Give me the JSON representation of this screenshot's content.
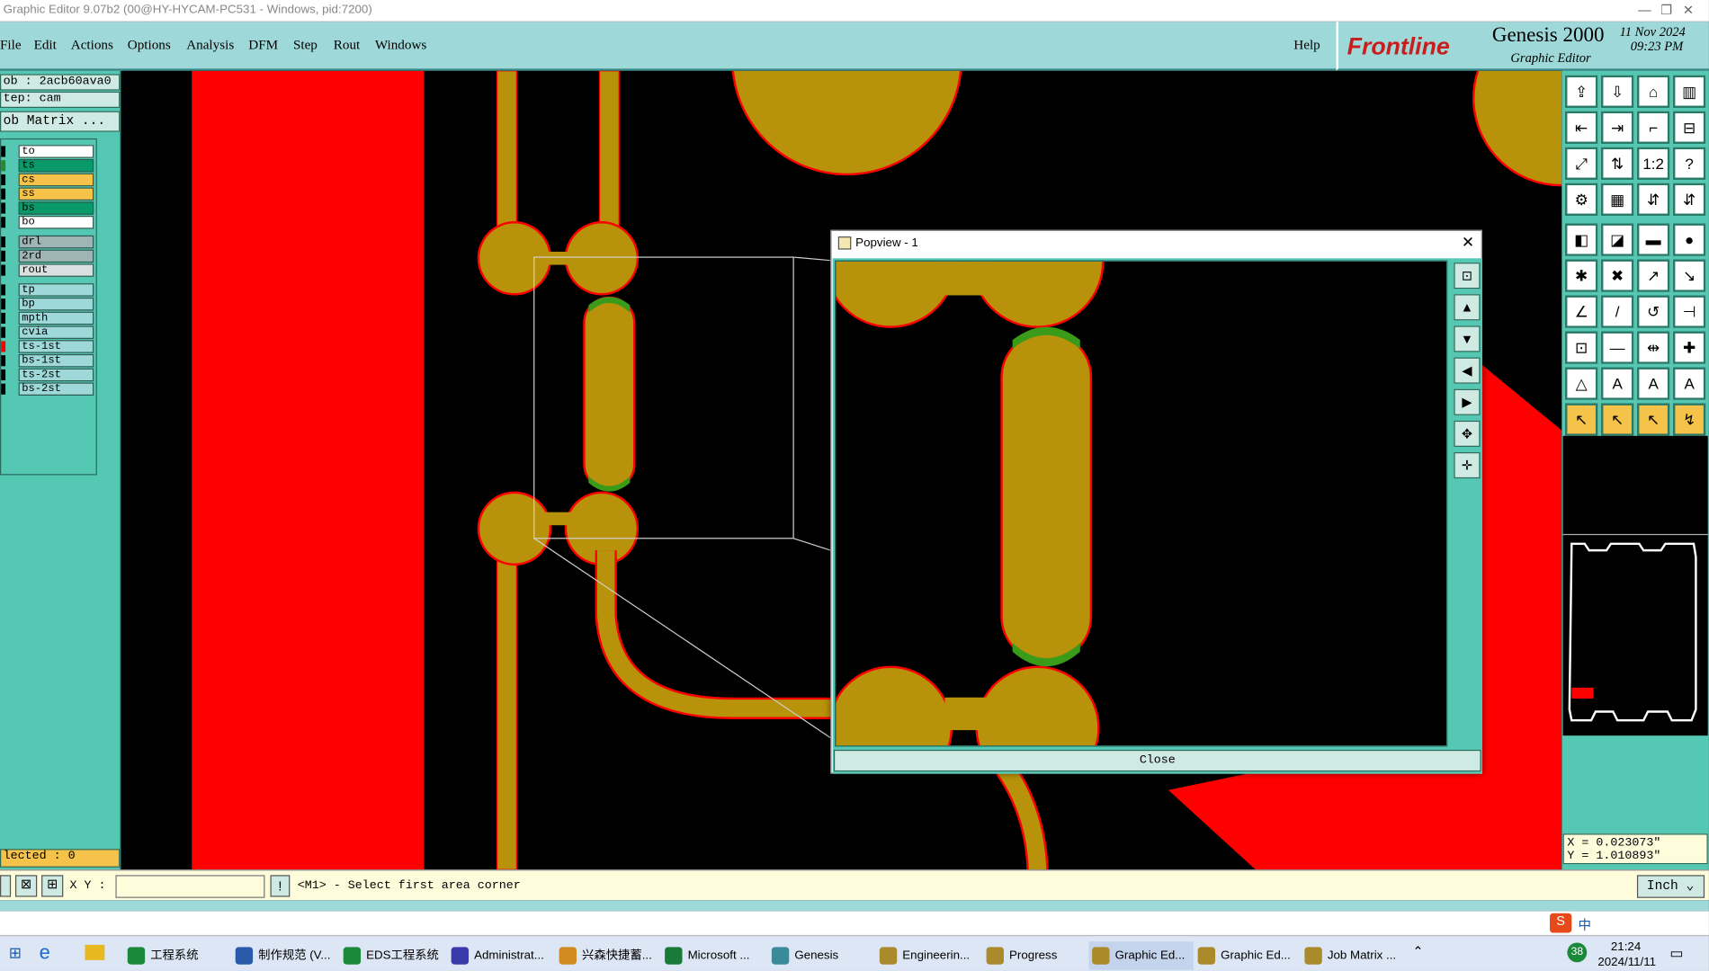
{
  "window_title": "Graphic Editor 9.07b2 (00@HY-HYCAM-PC531 - Windows, pid:7200)",
  "window_controls": {
    "minimize": "—",
    "restore": "❐",
    "close": "✕"
  },
  "menu": [
    "File",
    "Edit",
    "Actions",
    "Options",
    "Analysis",
    "DFM",
    "Step",
    "Rout",
    "Windows"
  ],
  "help": "Help",
  "brand": {
    "logo": "Frontline",
    "product": "Genesis 2000",
    "subtitle": "Graphic Editor",
    "date": "11 Nov 2024",
    "time": "09:23 PM"
  },
  "left_panel": {
    "job": "ob : 2acb60ava0",
    "step": "tep: cam",
    "job_matrix": "ob Matrix ...",
    "layers": [
      {
        "name": "to",
        "color": "#ffffff",
        "cb": "#000000"
      },
      {
        "name": "ts",
        "color": "#0a9a6a",
        "cb": "#2a8a2a"
      },
      {
        "name": "cs",
        "color": "#f5c34a",
        "cb": "#000000"
      },
      {
        "name": "ss",
        "color": "#f5c34a",
        "cb": "#000000"
      },
      {
        "name": "bs",
        "color": "#0a9a6a",
        "cb": "#000000"
      },
      {
        "name": "bo",
        "color": "#ffffff",
        "cb": "#000000"
      },
      {
        "name": "drl",
        "color": "#9fb5b5",
        "cb": "#000000"
      },
      {
        "name": "2rd",
        "color": "#9fb5b5",
        "cb": "#000000"
      },
      {
        "name": "rout",
        "color": "#d8e0e0",
        "cb": "#000000"
      },
      {
        "name": "tp",
        "color": "#9ed8d8",
        "cb": "#000000"
      },
      {
        "name": "bp",
        "color": "#9ed8d8",
        "cb": "#000000"
      },
      {
        "name": "mpth",
        "color": "#9ed8d8",
        "cb": "#000000"
      },
      {
        "name": "cvia",
        "color": "#9ed8d8",
        "cb": "#000000"
      },
      {
        "name": "ts-1st",
        "color": "#9ed8d8",
        "cb": "#ff0000"
      },
      {
        "name": "bs-1st",
        "color": "#9ed8d8",
        "cb": "#000000"
      },
      {
        "name": "ts-2st",
        "color": "#9ed8d8",
        "cb": "#000000"
      },
      {
        "name": "bs-2st",
        "color": "#9ed8d8",
        "cb": "#000000"
      }
    ],
    "selected": "lected : 0"
  },
  "popup": {
    "title": "Popview - 1",
    "close_label": "Close"
  },
  "coords": {
    "x": "X = 0.023073\"",
    "y": "Y = 1.010893\""
  },
  "status": {
    "xy_label": "X Y :",
    "xy_value": "",
    "message": "<M1> - Select first area corner",
    "units": "Inch"
  },
  "taskbar": [
    {
      "label": "工程系统",
      "color": "#1a8a3a"
    },
    {
      "label": "制作规范 (V...",
      "color": "#2a5aaa"
    },
    {
      "label": "EDS工程系统",
      "color": "#1a8a3a"
    },
    {
      "label": "Administrat...",
      "color": "#3a3aaa"
    },
    {
      "label": "兴森快捷蓄...",
      "color": "#d08a20"
    },
    {
      "label": "Microsoft ...",
      "color": "#1a7a3a"
    },
    {
      "label": "Genesis",
      "color": "#3a8a9a"
    },
    {
      "label": "Engineerin...",
      "color": "#aa8a2a"
    },
    {
      "label": "Progress",
      "color": "#aa8a2a"
    },
    {
      "label": "Graphic Ed...",
      "color": "#aa8a2a"
    },
    {
      "label": "Graphic Ed...",
      "color": "#aa8a2a"
    },
    {
      "label": "Job Matrix ...",
      "color": "#aa8a2a"
    }
  ],
  "tray": {
    "ime": "中",
    "badge": "38",
    "clock_time": "21:24",
    "clock_date": "2024/11/11"
  },
  "colors": {
    "board": "#b8920a",
    "copper_edge": "#ff0000",
    "mask": "#3a9a1a",
    "panel": "#55c8b4"
  }
}
